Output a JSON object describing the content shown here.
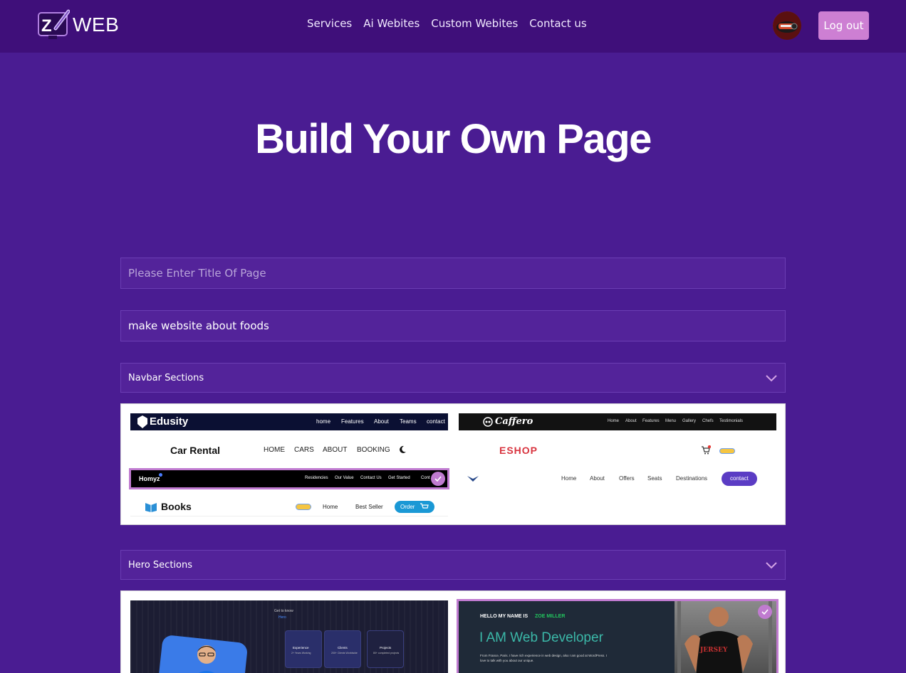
{
  "brand": {
    "name": "WEB"
  },
  "nav": {
    "items": [
      "Services",
      "Ai Webites",
      "Custom Webites",
      "Contact us"
    ]
  },
  "header": {
    "logout_label": "Log out"
  },
  "hero": {
    "title": "Build Your Own Page"
  },
  "form": {
    "title_placeholder": "Please Enter Title Of Page",
    "prompt_value": "make website about foods"
  },
  "sections": {
    "navbar_label": "Navbar Sections",
    "hero_label": "Hero Sections"
  },
  "navbar_templates": {
    "edusity": {
      "brand": "Edusity",
      "links": [
        "home",
        "Features",
        "About",
        "Teams",
        "contact"
      ]
    },
    "caffero": {
      "brand": "Caffero",
      "links": [
        "Home",
        "About",
        "Features",
        "Menu",
        "Gallery",
        "Chefs",
        "Testimonials"
      ]
    },
    "carrental": {
      "brand": "Car Rental",
      "links": [
        "HOME",
        "CARS",
        "ABOUT",
        "BOOKING"
      ]
    },
    "eshop": {
      "brand": "ESHOP"
    },
    "homyz": {
      "brand": "Homyz",
      "links": [
        "Residencies",
        "Our Value",
        "Contact Us",
        "Get Started",
        "Cont"
      ]
    },
    "travel": {
      "links": [
        "Home",
        "About",
        "Offers",
        "Seats",
        "Destinations"
      ],
      "cta": "contact"
    },
    "books": {
      "brand": "Books",
      "links": [
        "Home",
        "Best Seller"
      ],
      "cta": "Order"
    }
  },
  "hero_templates": {
    "portfolio1": {
      "kicker": "Get to know",
      "sub": "Hero",
      "cards": [
        {
          "title": "Experience",
          "text": "2+ Years Working"
        },
        {
          "title": "Clients",
          "text": "200+ Clients Worldwide"
        },
        {
          "title": "Projects",
          "text": "80+ completed projects"
        }
      ]
    },
    "portfolio2": {
      "greeting": "HELLO MY NAME IS",
      "name": "ZOE MILLER",
      "headline": "I AM Web Developer",
      "bio1": "From France, Paris. I have rich experience in web design, also I am good at WordPress. I",
      "bio2": "love to talk with you about our unique.",
      "jersey": "JERSEY"
    }
  },
  "colors": {
    "background": "#4a1c92",
    "header": "#3f0f7a",
    "accent": "#cd7fd3",
    "field": "#53239a"
  }
}
